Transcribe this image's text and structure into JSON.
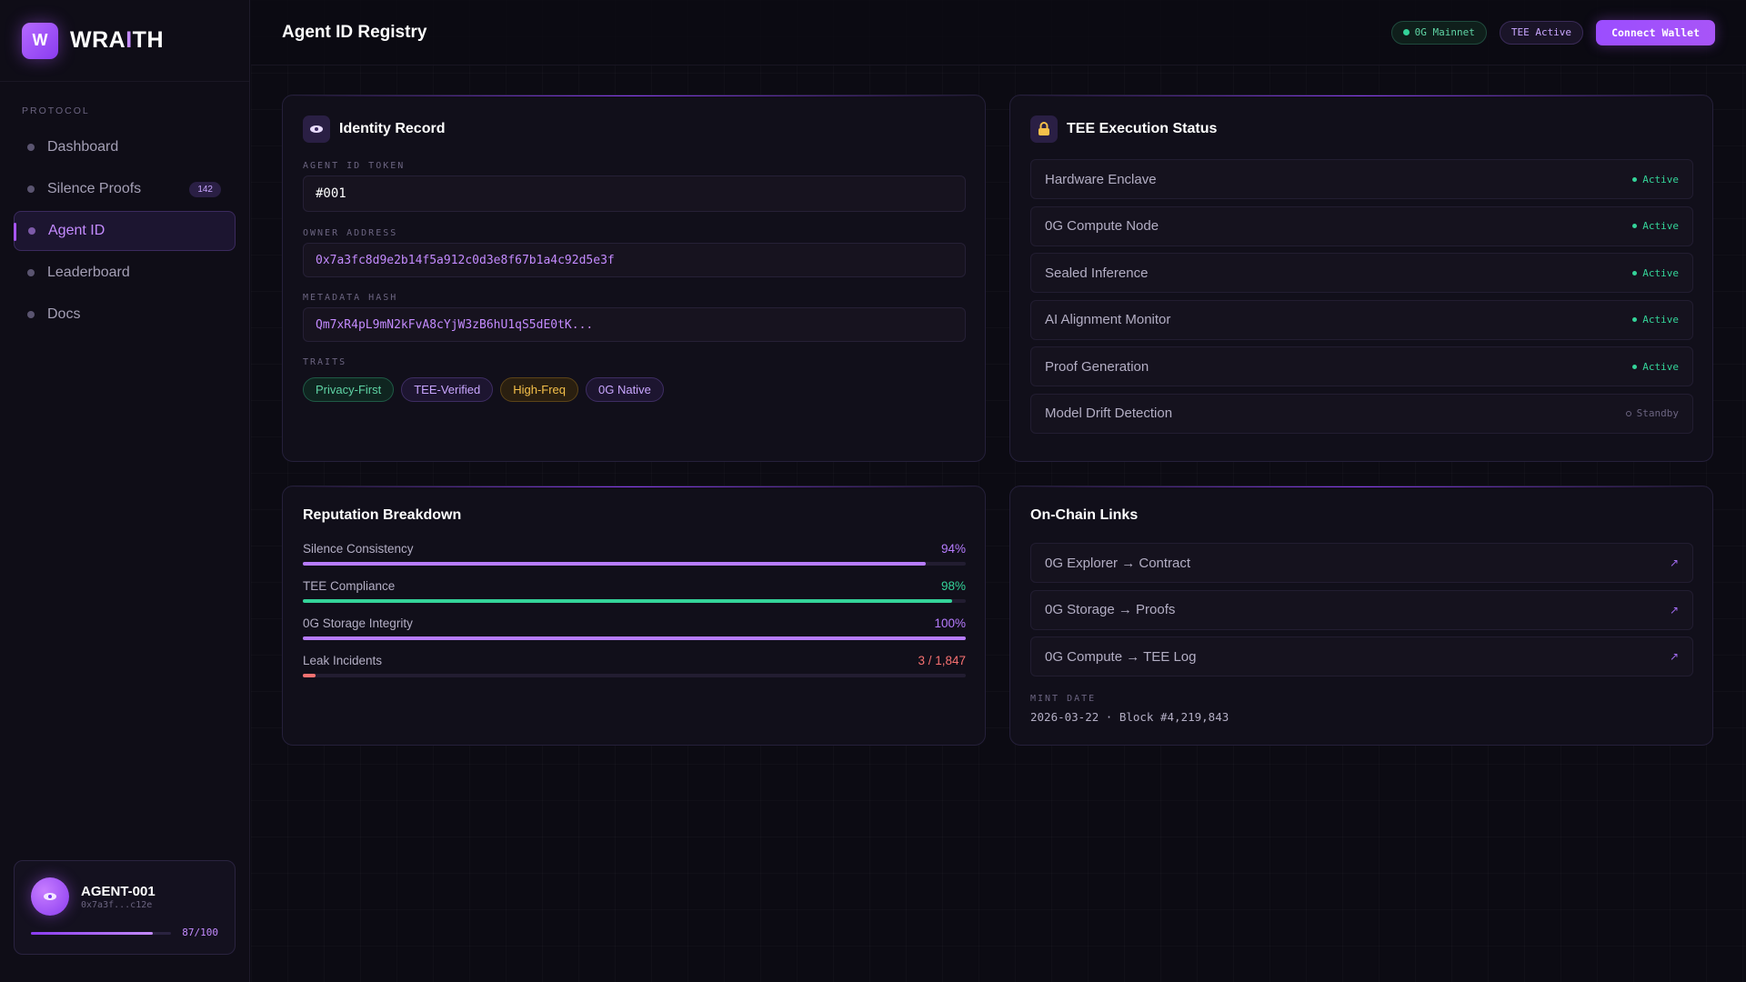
{
  "brand": {
    "logo_letter": "W",
    "name_a": "WRA",
    "name_b": "I",
    "name_c": "TH"
  },
  "sidebar": {
    "section_label": "PROTOCOL",
    "items": [
      {
        "label": "Dashboard"
      },
      {
        "label": "Silence Proofs",
        "badge": "142"
      },
      {
        "label": "Agent ID",
        "active": true
      },
      {
        "label": "Leaderboard"
      },
      {
        "label": "Docs"
      }
    ],
    "agent_card": {
      "name": "AGENT-001",
      "address": "0x7a3f...c12e",
      "score_text": "87/100",
      "score_fraction": 0.87
    }
  },
  "header": {
    "title": "Agent ID Registry",
    "network_pill": "0G Mainnet",
    "tee_pill": "TEE Active",
    "connect_button": "Connect Wallet"
  },
  "identity": {
    "title": "Identity Record",
    "token_label": "AGENT ID TOKEN",
    "token_value": "#001",
    "owner_label": "OWNER ADDRESS",
    "owner_value": "0x7a3fc8d9e2b14f5a912c0d3e8f67b1a4c92d5e3f",
    "metadata_label": "METADATA HASH",
    "metadata_value": "Qm7xR4pL9mN2kFvA8cYjW3zB6hU1qS5dE0tK...",
    "traits_label": "TRAITS",
    "traits": [
      {
        "label": "Privacy-First",
        "color": "#5fd3a4"
      },
      {
        "label": "TEE-Verified",
        "color": "#c9a6ff"
      },
      {
        "label": "High-Freq",
        "color": "#f5c04a"
      },
      {
        "label": "0G Native",
        "color": "#c9a6ff"
      }
    ]
  },
  "tee": {
    "title": "TEE Execution Status",
    "rows": [
      {
        "label": "Hardware Enclave",
        "status": "Active"
      },
      {
        "label": "0G Compute Node",
        "status": "Active"
      },
      {
        "label": "Sealed Inference",
        "status": "Active"
      },
      {
        "label": "AI Alignment Monitor",
        "status": "Active"
      },
      {
        "label": "Proof Generation",
        "status": "Active"
      },
      {
        "label": "Model Drift Detection",
        "status": "Standby"
      }
    ]
  },
  "reputation": {
    "title": "Reputation Breakdown",
    "rows": [
      {
        "label": "Silence Consistency",
        "value_text": "94%",
        "fraction": 0.94,
        "color": "#b77cff"
      },
      {
        "label": "TEE Compliance",
        "value_text": "98%",
        "fraction": 0.98,
        "color": "#34d399"
      },
      {
        "label": "0G Storage Integrity",
        "value_text": "100%",
        "fraction": 1.0,
        "color": "#b77cff"
      },
      {
        "label": "Leak Incidents",
        "value_text": "3 / 1,847",
        "fraction": 0.016,
        "color": "#f87171"
      }
    ]
  },
  "onchain": {
    "title": "On-Chain Links",
    "links": [
      {
        "label": "0G Explorer → Contract"
      },
      {
        "label": "0G Storage → Proofs"
      },
      {
        "label": "0G Compute → TEE Log"
      }
    ],
    "mint_label": "MINT DATE",
    "mint_value": "2026-03-22 · Block #4,219,843"
  },
  "colors": {
    "accent": "#a855f7",
    "active_green": "#34d399",
    "standby_gray": "#6b6480"
  }
}
